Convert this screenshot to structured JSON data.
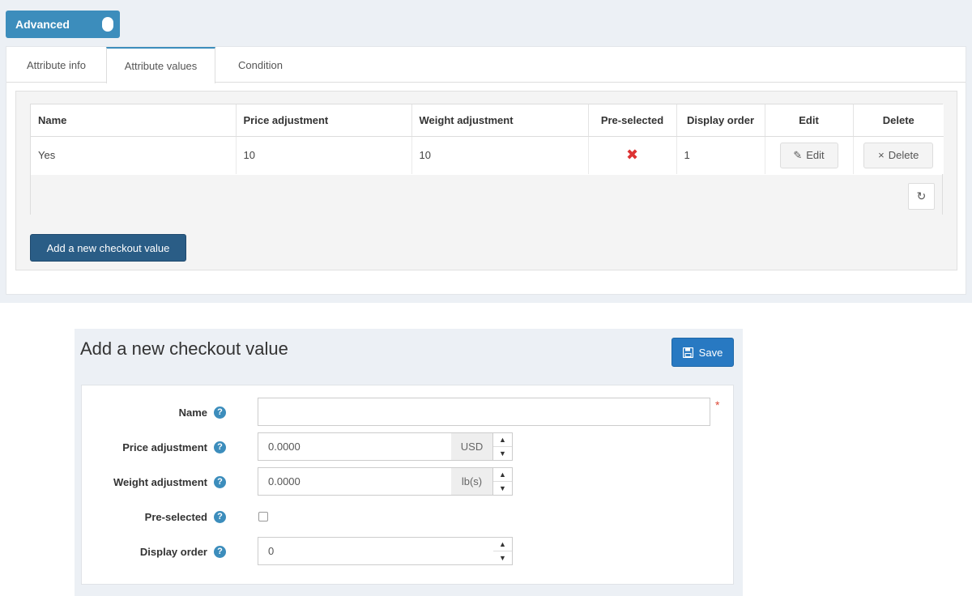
{
  "advanced_toggle": {
    "label": "Advanced"
  },
  "tabs": [
    {
      "label": "Attribute info"
    },
    {
      "label": "Attribute values"
    },
    {
      "label": "Condition"
    }
  ],
  "values_table": {
    "headers": {
      "name": "Name",
      "price": "Price adjustment",
      "weight": "Weight adjustment",
      "preselected": "Pre-selected",
      "order": "Display order",
      "edit": "Edit",
      "delete": "Delete"
    },
    "rows": [
      {
        "name": "Yes",
        "price": "10",
        "weight": "10",
        "preselected_icon": "x-icon",
        "order": "1",
        "edit_label": "Edit",
        "delete_label": "Delete"
      }
    ],
    "add_button": "Add a new checkout value"
  },
  "dialog": {
    "title": "Add a new checkout value",
    "save_label": "Save",
    "fields": {
      "name": {
        "label": "Name",
        "value": "",
        "required_mark": "*"
      },
      "price": {
        "label": "Price adjustment",
        "value": "0.0000",
        "unit": "USD"
      },
      "weight": {
        "label": "Weight adjustment",
        "value": "0.0000",
        "unit": "lb(s)"
      },
      "preselected": {
        "label": "Pre-selected",
        "checked": false
      },
      "order": {
        "label": "Display order",
        "value": "0"
      }
    }
  },
  "colors": {
    "accent": "#3c8dbc",
    "add_button": "#2a5d86",
    "save_button": "#2879c2",
    "delete_mark": "#dd3333"
  }
}
